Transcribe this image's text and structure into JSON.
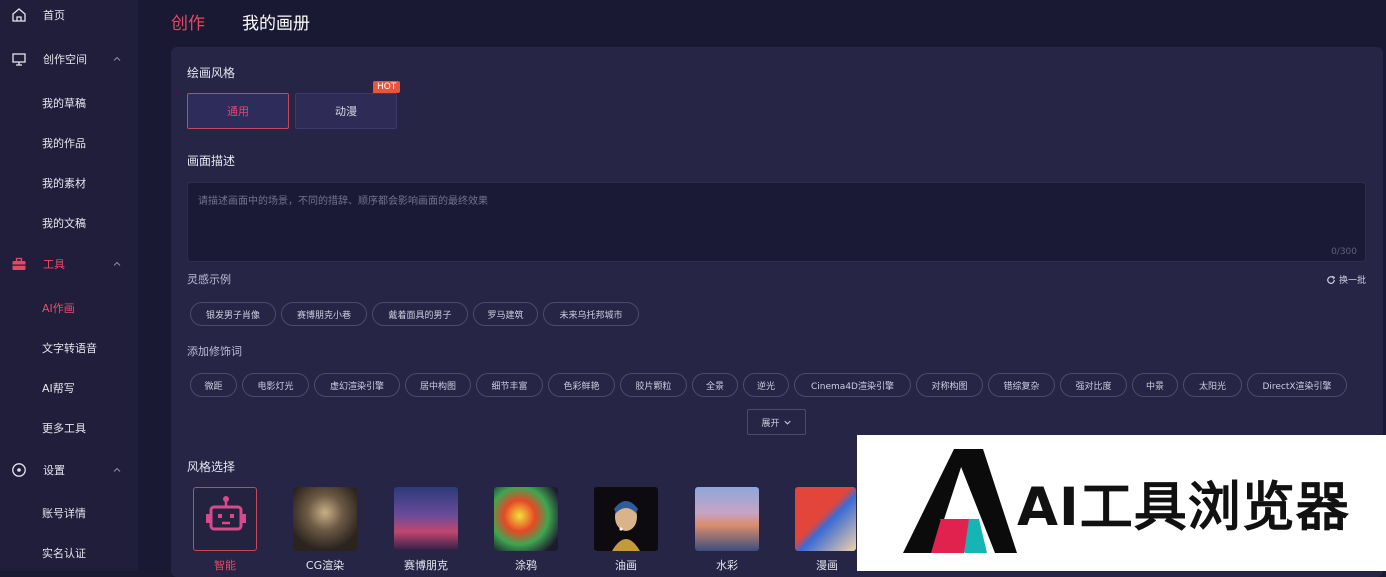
{
  "sidebar": {
    "items": [
      {
        "label": "首页",
        "icon": "home-icon"
      },
      {
        "label": "创作空间",
        "icon": "monitor-icon"
      },
      {
        "label": "我的草稿"
      },
      {
        "label": "我的作品"
      },
      {
        "label": "我的素材"
      },
      {
        "label": "我的文稿"
      },
      {
        "label": "工具",
        "icon": "toolbox-icon"
      },
      {
        "label": "AI作画"
      },
      {
        "label": "文字转语音"
      },
      {
        "label": "AI帮写"
      },
      {
        "label": "更多工具"
      },
      {
        "label": "设置",
        "icon": "settings-icon"
      },
      {
        "label": "账号详情"
      },
      {
        "label": "实名认证"
      }
    ]
  },
  "header": {
    "tab_create": "创作",
    "tab_album": "我的画册"
  },
  "form": {
    "style_label": "绘画风格",
    "style_options": [
      "通用",
      "动漫"
    ],
    "hot_badge": "HOT",
    "desc_label": "画面描述",
    "desc_placeholder": "请描述画面中的场景，不同的措辞、顺序都会影响画面的最终效果",
    "desc_counter": "0/300",
    "inspiration_label": "灵感示例",
    "refresh_label": "换一批",
    "inspiration_chips": [
      "银发男子肖像",
      "赛博朋克小巷",
      "戴着面具的男子",
      "罗马建筑",
      "未来乌托邦城市"
    ],
    "modifier_label": "添加修饰词",
    "modifier_chips": [
      "微距",
      "电影灯光",
      "虚幻渲染引擎",
      "居中构图",
      "细节丰富",
      "色彩鲜艳",
      "胶片颗粒",
      "全景",
      "逆光",
      "Cinema4D渲染引擎",
      "对称构图",
      "错综复杂",
      "强对比度",
      "中景",
      "太阳光",
      "DirectX渲染引擎"
    ],
    "expand_label": "展开",
    "style_select_label": "风格选择",
    "styles": [
      "智能",
      "CG渲染",
      "赛博朋克",
      "涂鸦",
      "油画",
      "水彩",
      "漫画"
    ]
  },
  "watermark": {
    "text": "AI工具浏览器"
  },
  "colors": {
    "accent": "#e24a64",
    "bg": "#1a1933",
    "panel": "#262545"
  }
}
